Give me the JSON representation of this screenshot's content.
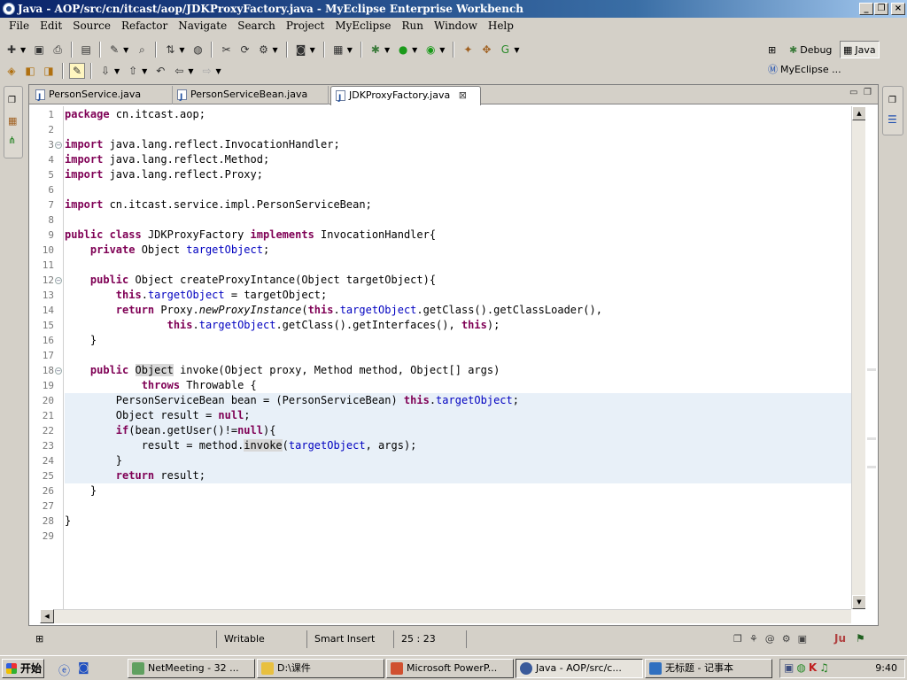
{
  "window": {
    "title": "Java - AOP/src/cn/itcast/aop/JDKProxyFactory.java - MyEclipse Enterprise Workbench"
  },
  "menu": [
    "File",
    "Edit",
    "Source",
    "Refactor",
    "Navigate",
    "Search",
    "Project",
    "MyEclipse",
    "Run",
    "Window",
    "Help"
  ],
  "perspectives": {
    "debug_label": "Debug",
    "java_label": "Java",
    "myeclipse_label": "MyEclipse ..."
  },
  "tabs": [
    {
      "label": "PersonService.java"
    },
    {
      "label": "PersonServiceBean.java"
    },
    {
      "label": "JDKProxyFactory.java",
      "active": true
    }
  ],
  "editor": {
    "lines": [
      "package cn.itcast.aop;",
      "",
      "import java.lang.reflect.InvocationHandler;",
      "import java.lang.reflect.Method;",
      "import java.lang.reflect.Proxy;",
      "",
      "import cn.itcast.service.impl.PersonServiceBean;",
      "",
      "public class JDKProxyFactory implements InvocationHandler{",
      "    private Object targetObject;",
      "",
      "    public Object createProxyIntance(Object targetObject){",
      "        this.targetObject = targetObject;",
      "        return Proxy.newProxyInstance(this.targetObject.getClass().getClassLoader(),",
      "                this.targetObject.getClass().getInterfaces(), this);",
      "    }",
      "",
      "    public Object invoke(Object proxy, Method method, Object[] args)",
      "            throws Throwable {",
      "        PersonServiceBean bean = (PersonServiceBean) this.targetObject;",
      "        Object result = null;",
      "        if(bean.getUser()!=null){",
      "            result = method.invoke(targetObject, args);",
      "        }",
      "        return result;",
      "    }",
      "",
      "}",
      ""
    ],
    "fold_lines": [
      3,
      12,
      18
    ]
  },
  "status": {
    "mode": "Writable",
    "insert": "Smart Insert",
    "position": "25 : 23"
  },
  "taskbar": {
    "start_label": "开始",
    "tasks": [
      {
        "label": "NetMeeting - 32 ..."
      },
      {
        "label": "D:\\课件"
      },
      {
        "label": "Microsoft PowerP..."
      },
      {
        "label": "Java - AOP/src/c...",
        "active": true
      },
      {
        "label": "无标题 - 记事本"
      }
    ],
    "clock": "9:40"
  }
}
